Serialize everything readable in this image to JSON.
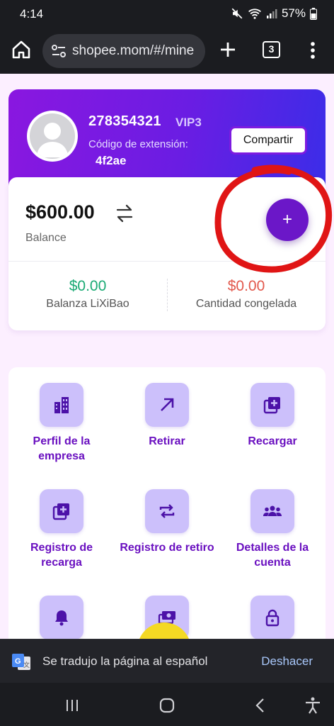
{
  "status_bar": {
    "time": "4:14",
    "battery": "57%"
  },
  "browser": {
    "url": "shopee.mom/#/mine",
    "tab_count": "3"
  },
  "profile": {
    "user_id": "278354321",
    "vip": "VIP3",
    "extension_label": "Código de extensión:",
    "extension_code": "4f2ae",
    "share_label": "Compartir"
  },
  "balance": {
    "amount": "$600.00",
    "label": "Balance",
    "add_symbol": "+",
    "lixibao_value": "$0.00",
    "lixibao_label": "Balanza LiXiBao",
    "frozen_value": "$0.00",
    "frozen_label": "Cantidad congelada"
  },
  "menu": {
    "items": [
      {
        "label": "Perfil de la empresa",
        "icon": "building-icon"
      },
      {
        "label": "Retirar",
        "icon": "arrow-up-right-icon"
      },
      {
        "label": "Recargar",
        "icon": "add-box-icon"
      },
      {
        "label": "Registro de recarga",
        "icon": "add-box-icon"
      },
      {
        "label": "Registro de retiro",
        "icon": "repeat-icon"
      },
      {
        "label": "Detalles de la cuenta",
        "icon": "group-icon"
      }
    ]
  },
  "translate_bar": {
    "message": "Se tradujo la página al español",
    "undo_label": "Deshacer"
  },
  "colors": {
    "accent": "#6b17c8",
    "gradient_start": "#8a17e0",
    "gradient_end": "#3b2de8",
    "annotation": "#e01515",
    "green": "#1aaa74",
    "red": "#e2584c"
  }
}
